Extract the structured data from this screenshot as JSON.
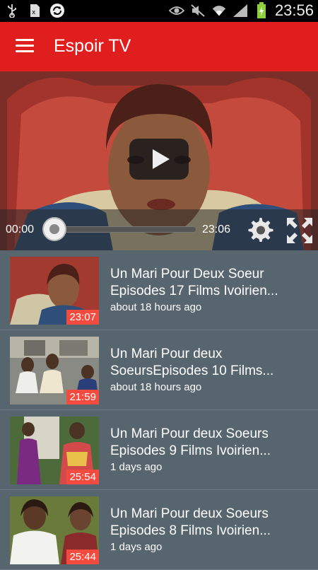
{
  "status_bar": {
    "time": "23:56",
    "left_icons": [
      "usb-icon",
      "sim-card-icon",
      "sync-icon"
    ],
    "right_icons": [
      "eye-icon",
      "mute-icon",
      "wifi-icon",
      "signal-icon",
      "battery-icon"
    ]
  },
  "app_bar": {
    "title": "Espoir TV",
    "menu_icon": "hamburger-icon"
  },
  "player": {
    "current_time": "00:00",
    "duration": "23:06",
    "progress": 0.0,
    "buttons": [
      "settings-icon",
      "fullscreen-icon",
      "play-icon"
    ]
  },
  "videos": [
    {
      "title_line1": "Un Mari Pour Deux Soeur",
      "title_line2": "Episodes 17  Films Ivoirien...",
      "ago": "about 18 hours ago",
      "duration": "23:07"
    },
    {
      "title_line1": "Un Mari Pour deux",
      "title_line2": "SoeursEpisodes 10  Films...",
      "ago": "about 18 hours ago",
      "duration": "21:59"
    },
    {
      "title_line1": "Un Mari Pour deux  Soeurs",
      "title_line2": "Episodes 9 Films Ivoirien...",
      "ago": "1 days ago",
      "duration": "25:54"
    },
    {
      "title_line1": "Un Mari Pour deux  Soeurs",
      "title_line2": "Episodes 8  Films Ivoirien...",
      "ago": "1 days ago",
      "duration": "25:44"
    }
  ],
  "colors": {
    "accent": "#e01e1e",
    "list_background": "#56656e",
    "duration_badge": "#f44b40"
  }
}
